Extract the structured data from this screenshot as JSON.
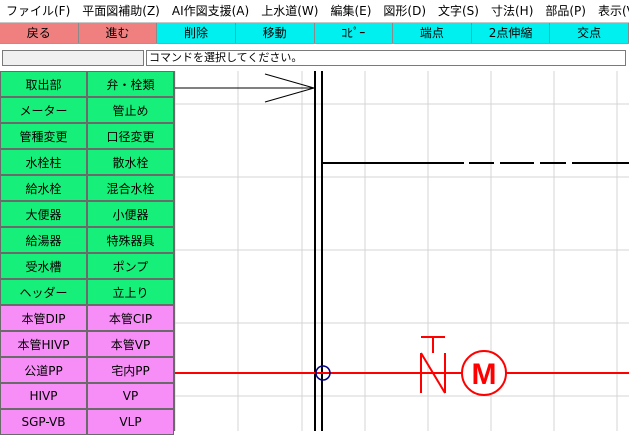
{
  "menubar": {
    "items": [
      {
        "label": "ファイル(F)"
      },
      {
        "label": "平面図補助(Z)"
      },
      {
        "label": "AI作図支援(A)"
      },
      {
        "label": "上水道(W)"
      },
      {
        "label": "編集(E)"
      },
      {
        "label": "図形(D)"
      },
      {
        "label": "文字(S)"
      },
      {
        "label": "寸法(H)"
      },
      {
        "label": "部品(P)"
      },
      {
        "label": "表示(V)"
      }
    ]
  },
  "toolbar": {
    "buttons": [
      {
        "label": "戻る",
        "color": "#f08080"
      },
      {
        "label": "進む",
        "color": "#f08080"
      },
      {
        "label": "削除",
        "color": "#00f0f0"
      },
      {
        "label": "移動",
        "color": "#00f0f0"
      },
      {
        "label": "ｺﾋﾟｰ",
        "color": "#00f0f0"
      },
      {
        "label": "端点",
        "color": "#00f0f0"
      },
      {
        "label": "2点伸縮",
        "color": "#00f0f0"
      },
      {
        "label": "交点",
        "color": "#00f0f0"
      }
    ]
  },
  "status": {
    "prompt": "コマンドを選択してください。"
  },
  "palette": {
    "items": [
      {
        "label": "取出部",
        "group": "green"
      },
      {
        "label": "弁・栓類",
        "group": "green"
      },
      {
        "label": "メーター",
        "group": "green"
      },
      {
        "label": "管止め",
        "group": "green"
      },
      {
        "label": "管種変更",
        "group": "green"
      },
      {
        "label": "口径変更",
        "group": "green"
      },
      {
        "label": "水栓柱",
        "group": "green"
      },
      {
        "label": "散水栓",
        "group": "green"
      },
      {
        "label": "給水栓",
        "group": "green"
      },
      {
        "label": "混合水栓",
        "group": "green"
      },
      {
        "label": "大便器",
        "group": "green"
      },
      {
        "label": "小便器",
        "group": "green"
      },
      {
        "label": "給湯器",
        "group": "green"
      },
      {
        "label": "特殊器具",
        "group": "green"
      },
      {
        "label": "受水槽",
        "group": "green"
      },
      {
        "label": "ポンプ",
        "group": "green"
      },
      {
        "label": "ヘッダー",
        "group": "green"
      },
      {
        "label": "立上り",
        "group": "green"
      },
      {
        "label": "本管DIP",
        "group": "pink"
      },
      {
        "label": "本管CIP",
        "group": "pink"
      },
      {
        "label": "本管HIVP",
        "group": "pink"
      },
      {
        "label": "本管VP",
        "group": "pink"
      },
      {
        "label": "公道PP",
        "group": "pink"
      },
      {
        "label": "宅内PP",
        "group": "pink"
      },
      {
        "label": "HIVP",
        "group": "pink"
      },
      {
        "label": "VP",
        "group": "pink"
      },
      {
        "label": "SGP-VB",
        "group": "pink"
      },
      {
        "label": "VLP",
        "group": "pink"
      }
    ]
  },
  "canvas": {
    "meter_label": "M",
    "colors": {
      "grid": "#d4d4d4",
      "wall": "#000000",
      "pipe": "#ff0000",
      "node": "#000080"
    }
  }
}
